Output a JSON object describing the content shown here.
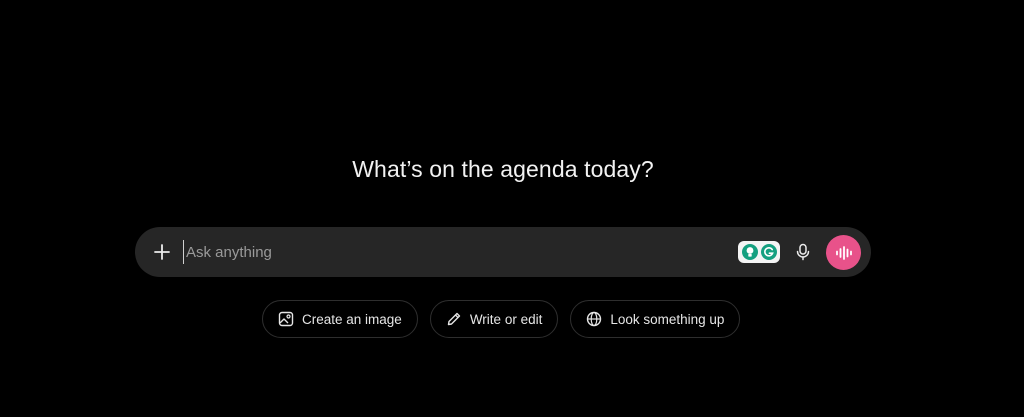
{
  "headline": "What’s on the agenda today?",
  "composer": {
    "placeholder": "Ask anything",
    "value": "",
    "icons": {
      "add": "plus-icon",
      "extension_left": "lightbulb-icon",
      "extension_right": "grammarly-icon",
      "mic": "microphone-icon",
      "voice": "voice-waveform-icon"
    }
  },
  "chips": [
    {
      "label": "Create an image",
      "icon": "image-icon"
    },
    {
      "label": "Write or edit",
      "icon": "pencil-icon"
    },
    {
      "label": "Look something up",
      "icon": "globe-icon"
    }
  ],
  "colors": {
    "background": "#000000",
    "composer_bg": "#262626",
    "voice_button": "#e8528a",
    "extension_green": "#15a080",
    "chip_border": "#2e2e2e"
  }
}
